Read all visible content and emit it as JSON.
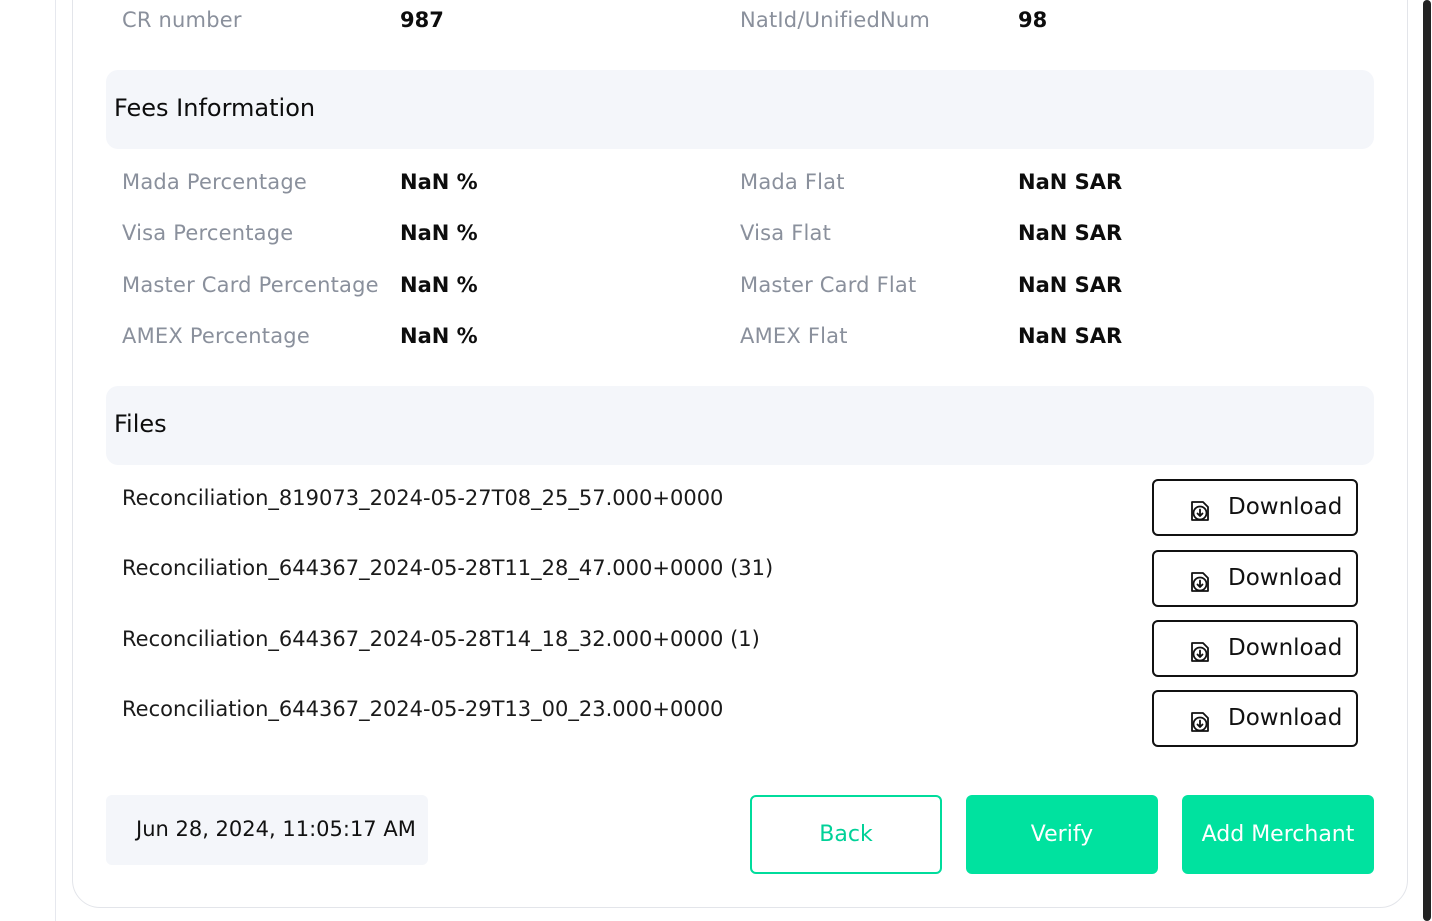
{
  "top_row": {
    "cr_label": "CR number",
    "cr_value": "987",
    "natid_label": "NatId/UnifiedNum",
    "natid_value": "98"
  },
  "fees": {
    "title": "Fees Information",
    "rows": [
      {
        "left_label": "Mada Percentage",
        "left_value": "NaN %",
        "right_label": "Mada Flat",
        "right_value": "NaN SAR"
      },
      {
        "left_label": "Visa Percentage",
        "left_value": "NaN %",
        "right_label": "Visa Flat",
        "right_value": "NaN SAR"
      },
      {
        "left_label": "Master Card Percentage",
        "left_value": "NaN %",
        "right_label": "Master Card Flat",
        "right_value": "NaN SAR"
      },
      {
        "left_label": "AMEX Percentage",
        "left_value": "NaN %",
        "right_label": "AMEX Flat",
        "right_value": "NaN SAR"
      }
    ]
  },
  "files": {
    "title": "Files",
    "download_label": "Download",
    "download_icon": "download-icon",
    "items": [
      {
        "name": "Reconciliation_819073_2024-05-27T08_25_57.000+0000"
      },
      {
        "name": "Reconciliation_644367_2024-05-28T11_28_47.000+0000 (31)"
      },
      {
        "name": "Reconciliation_644367_2024-05-28T14_18_32.000+0000 (1)"
      },
      {
        "name": "Reconciliation_644367_2024-05-29T13_00_23.000+0000"
      }
    ]
  },
  "footer": {
    "timestamp": "Jun 28, 2024, 11:05:17 AM",
    "back_label": "Back",
    "verify_label": "Verify",
    "add_merchant_label": "Add Merchant"
  },
  "colors": {
    "accent": "#00e29f",
    "header_bg": "#f4f6fa",
    "label_gray": "#8a909c"
  }
}
